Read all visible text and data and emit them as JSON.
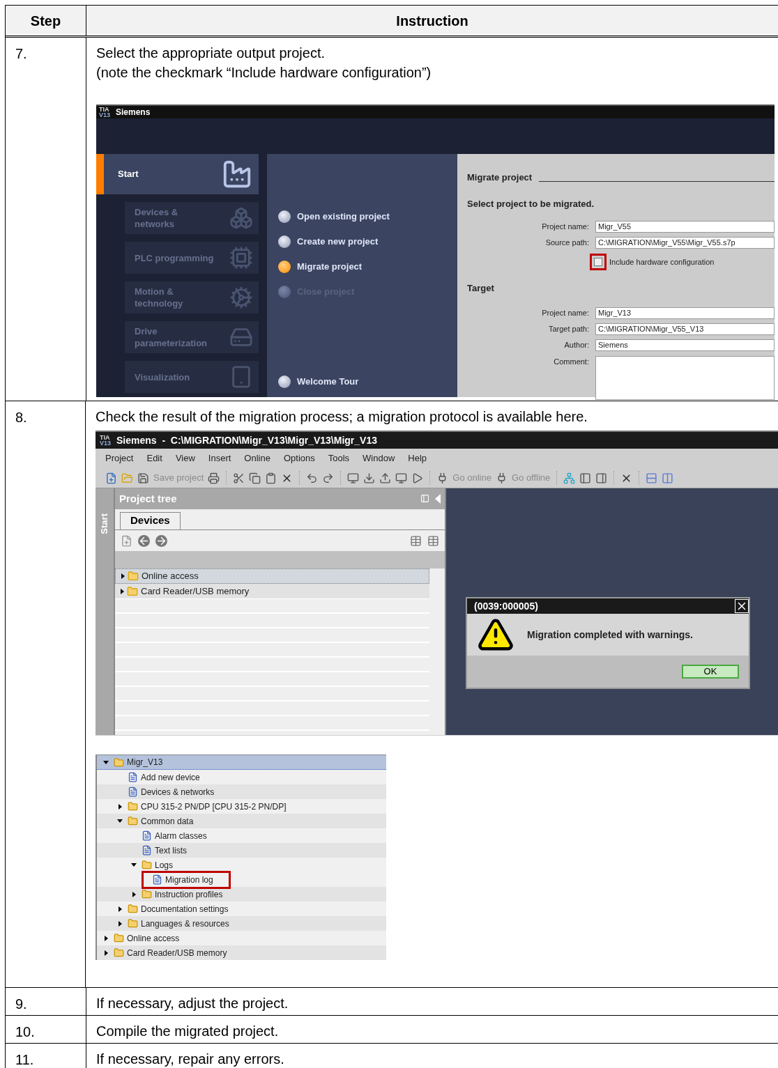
{
  "table": {
    "columns": [
      "Step",
      "Instruction"
    ],
    "steps": [
      {
        "number": "7.",
        "kind": "portal",
        "lines": [
          "Select the appropriate output project.",
          "(note the checkmark “Include hardware configuration”)"
        ]
      },
      {
        "number": "8.",
        "kind": "project_view",
        "lines": [
          "Check the result of the migration process; a migration protocol is available here."
        ]
      },
      {
        "number": "9.",
        "kind": "text",
        "lines": [
          "If necessary, adjust the project."
        ]
      },
      {
        "number": "10.",
        "kind": "text",
        "lines": [
          "Compile the migrated project."
        ]
      },
      {
        "number": "11.",
        "kind": "text",
        "lines": [
          "If necessary, repair any errors."
        ]
      }
    ]
  },
  "portal": {
    "logo_top": "TIA",
    "logo_bottom": "V13",
    "title": "Siemens",
    "nav": [
      {
        "label": "Start",
        "selected": true
      },
      {
        "label": "Devices & networks",
        "selected": false
      },
      {
        "label": "PLC programming",
        "selected": false
      },
      {
        "label": "Motion & technology",
        "selected": false
      },
      {
        "label": "Drive parameterization",
        "selected": false
      },
      {
        "label": "Visualization",
        "selected": false
      }
    ],
    "actions": [
      {
        "label": "Open existing project",
        "selected": false,
        "disabled": false
      },
      {
        "label": "Create new project",
        "selected": false,
        "disabled": false
      },
      {
        "label": "Migrate project",
        "selected": true,
        "disabled": false
      },
      {
        "label": "Close project",
        "selected": false,
        "disabled": true
      },
      {
        "label": "Welcome Tour",
        "selected": false,
        "disabled": false
      }
    ],
    "pane_title": "Migrate project",
    "source_heading": "Select project to be migrated.",
    "source_fields": [
      {
        "label": "Project name:",
        "value": "Migr_V55"
      },
      {
        "label": "Source path:",
        "value": "C:\\MIGRATION\\Migr_V55\\Migr_V55.s7p"
      }
    ],
    "checkbox": {
      "label": "Include hardware configuration",
      "checked": false,
      "highlighted": true
    },
    "target_heading": "Target",
    "target_fields": [
      {
        "label": "Project name:",
        "value": "Migr_V13"
      },
      {
        "label": "Target path:",
        "value": "C:\\MIGRATION\\Migr_V55_V13"
      },
      {
        "label": "Author:",
        "value": "Siemens"
      }
    ],
    "comment_label": "Comment:"
  },
  "project_view": {
    "logo_top": "TIA",
    "logo_bottom": "V13",
    "title": "Siemens  -  C:\\MIGRATION\\Migr_V13\\Migr_V13\\Migr_V13",
    "menu": [
      "Project",
      "Edit",
      "View",
      "Insert",
      "Online",
      "Options",
      "Tools",
      "Window",
      "Help"
    ],
    "toolbar_labels": [
      "Save project",
      "Go online",
      "Go offline"
    ],
    "side_tab": "Start",
    "tree_title": "Project tree",
    "tabs": [
      {
        "label": "Devices",
        "selected": true
      }
    ],
    "tree": [
      {
        "label": "Online access",
        "expanded": false,
        "selected": true
      },
      {
        "label": "Card Reader/USB memory",
        "expanded": false,
        "selected": false
      }
    ],
    "dialog": {
      "title": "(0039:000005)",
      "message": "Migration completed with warnings.",
      "button": "OK"
    }
  },
  "project_tree": [
    {
      "label": "Migr_V13",
      "expanded": true,
      "selected": true,
      "highlighted": false,
      "children": [
        {
          "label": "Add new device",
          "selected": false,
          "highlighted": false
        },
        {
          "label": "Devices & networks",
          "selected": false,
          "highlighted": false
        },
        {
          "label": "CPU 315-2 PN/DP [CPU 315-2 PN/DP]",
          "expanded": false,
          "selected": false,
          "highlighted": false
        },
        {
          "label": "Common data",
          "expanded": true,
          "selected": false,
          "highlighted": false,
          "children": [
            {
              "label": "Alarm classes",
              "selected": false,
              "highlighted": false
            },
            {
              "label": "Text lists",
              "selected": false,
              "highlighted": false
            },
            {
              "label": "Logs",
              "expanded": true,
              "selected": false,
              "highlighted": false,
              "children": [
                {
                  "label": "Migration log",
                  "selected": false,
                  "highlighted": true
                }
              ]
            },
            {
              "label": "Instruction profiles",
              "expanded": false,
              "selected": false,
              "highlighted": false
            }
          ]
        },
        {
          "label": "Documentation settings",
          "expanded": false,
          "selected": false,
          "highlighted": false
        },
        {
          "label": "Languages & resources",
          "expanded": false,
          "selected": false,
          "highlighted": false
        }
      ]
    },
    {
      "label": "Online access",
      "expanded": false,
      "selected": false,
      "highlighted": false
    },
    {
      "label": "Card Reader/USB memory",
      "expanded": false,
      "selected": false,
      "highlighted": false
    }
  ]
}
